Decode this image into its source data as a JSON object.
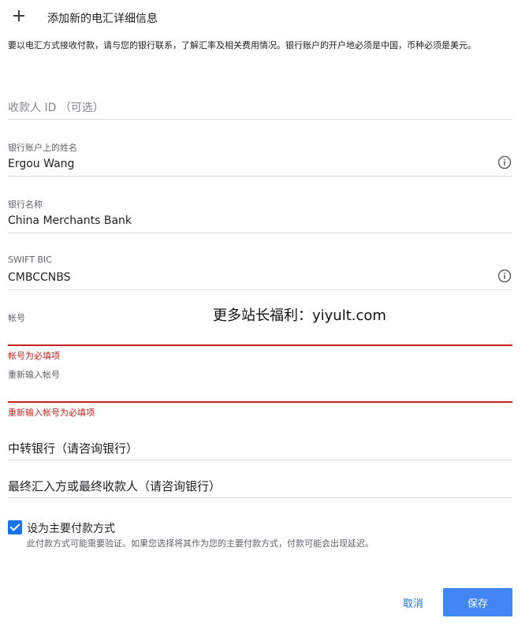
{
  "header": {
    "add_icon": "plus-icon",
    "title": "添加新的电汇详细信息"
  },
  "intro": "要以电汇方式接收付款，请与您的银行联系，了解汇率及相关费用情况。银行账户的开户地必须是中国，币种必须是美元。",
  "fields": {
    "payee_id": {
      "placeholder": "收款人 ID （可选）"
    },
    "account_name": {
      "label": "银行账户上的姓名",
      "value": "Ergou Wang",
      "icon": "info-icon"
    },
    "bank_name": {
      "label": "银行名称",
      "value": "China Merchants Bank"
    },
    "swift": {
      "label": "SWIFT BIC",
      "value": "CMBCCNBS",
      "icon": "info-icon"
    },
    "account_number": {
      "label": "帐号",
      "value": "",
      "error": "帐号为必填项"
    },
    "account_number_confirm": {
      "label": "重新输入帐号",
      "value": "",
      "error": "重新输入帐号为必填项"
    },
    "intermediary_bank": {
      "label": "中转银行（请咨询银行）"
    },
    "final_beneficiary": {
      "label": "最终汇入方或最终收款人（请咨询银行）"
    }
  },
  "watermark": "更多站长福利：yiyult.com",
  "primary": {
    "checked": true,
    "label": "设为主要付款方式",
    "sub": "此付款方式可能需要验证。如果您选择将其作为您的主要付款方式，付款可能会出现延迟。"
  },
  "footer": {
    "cancel_label": "取消",
    "save_label": "保存"
  },
  "colors": {
    "accent": "#1a73e8",
    "save_button": "#4285f4",
    "error": "#c5221f",
    "divider": "#dadce0"
  }
}
